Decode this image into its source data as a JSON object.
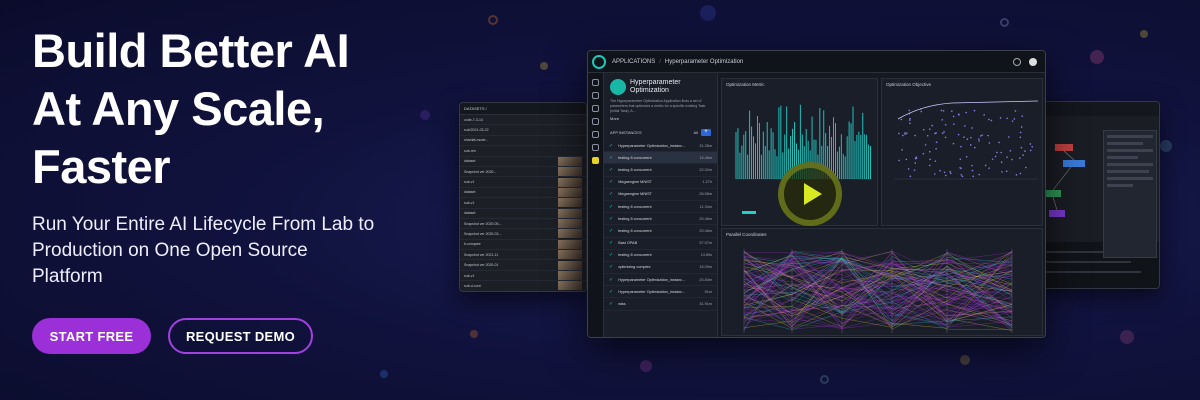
{
  "hero": {
    "headline_lines": [
      "Build Better AI",
      "At Any Scale,",
      "Faster"
    ],
    "subline_lines": [
      "Run Your Entire AI Lifecycle From Lab to",
      "Production on One Open Source",
      "Platform"
    ]
  },
  "buttons": {
    "start": "START FREE",
    "demo": "REQUEST DEMO"
  },
  "colors": {
    "accent_purple": "#9b30d9",
    "teal": "#19c9b6",
    "play_yellow": "#d7ea22",
    "background": "#11133f"
  },
  "app_window": {
    "breadcrumb": [
      "APPLICATIONS",
      "Hyperparameter Optimization"
    ],
    "app_title": "Hyperparameter Optimization",
    "app_desc": "The Hyperparameter Optimization Application finds a set of parameters that optimizes a metric for a specific existing Task (Initial Task). A...",
    "more_label": "More",
    "instances_label": "APP INSTANCES",
    "filter_label": "All",
    "instances": [
      {
        "name": "Hyperparameter Optimization_instanc...",
        "time": "31.28m"
      },
      {
        "name": "testing 8 concurrent",
        "time": "15.46m"
      },
      {
        "name": "testing 8 concurrent",
        "time": "22.02m"
      },
      {
        "name": "Megaengine MNIST",
        "time": "1.27h"
      },
      {
        "name": "Megaengine MNIST",
        "time": "26.58m"
      },
      {
        "name": "testing 8 concurrent",
        "time": "11.34m"
      },
      {
        "name": "testing 8 concurrent",
        "time": "20.46m"
      },
      {
        "name": "testing 8 concurrent",
        "time": "20.46m"
      },
      {
        "name": "Bast OPAB",
        "time": "57.07m"
      },
      {
        "name": "testing 8 concurrent",
        "time": "14.69s"
      },
      {
        "name": "optimizing complex",
        "time": "15.09m"
      },
      {
        "name": "Hyperparameter Optimization_instanc...",
        "time": "20.83m"
      },
      {
        "name": "Hyperparameter Optimization_instanc...",
        "time": "51m"
      },
      {
        "name": "wiss",
        "time": "31.91m"
      }
    ],
    "panes": {
      "metric": "Optimization Metric",
      "objective": "Optimization Objective",
      "parallel": "Parallel Coordinates"
    }
  },
  "side_left": {
    "header": "DATASETS / ",
    "rows": [
      "code-7-3-14",
      "sub/2021-03-22",
      "sha/dat-mode...",
      "sub-ren",
      "dataset",
      "Snapshot ver 2020-..",
      "sub-v1",
      "dataset",
      "sub-v1",
      "dataset",
      "Snapshot ver 2020-05-..",
      "Snapshot ver 2020-02-..",
      "b-compare",
      "Snapshot ver 2021-11",
      "Snapshot ver 2020-01",
      "sub-v1",
      "sub-d-cont",
      "sub-d"
    ]
  }
}
